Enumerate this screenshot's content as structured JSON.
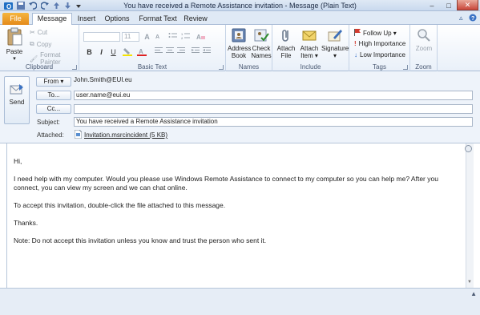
{
  "window": {
    "title": "You have received a Remote Assistance invitation  -  Message (Plain Text)",
    "minimize": "–",
    "maximize": "□",
    "close": "✕"
  },
  "tabs": {
    "file": "File",
    "items": [
      "Message",
      "Insert",
      "Options",
      "Format Text",
      "Review"
    ],
    "active": "Message"
  },
  "ribbon": {
    "clipboard": {
      "label": "Clipboard",
      "paste": "Paste",
      "cut": "Cut",
      "copy": "Copy",
      "format_painter": "Format Painter"
    },
    "basic_text": {
      "label": "Basic Text",
      "font_size": "11"
    },
    "names": {
      "label": "Names",
      "address_book": [
        "Address",
        "Book"
      ],
      "check_names": [
        "Check",
        "Names"
      ]
    },
    "include": {
      "label": "Include",
      "attach_file": [
        "Attach",
        "File"
      ],
      "attach_item": [
        "Attach",
        "Item ▾"
      ],
      "signature": [
        "Signature",
        "▾"
      ]
    },
    "tags": {
      "label": "Tags",
      "follow_up": "Follow Up ▾",
      "high_importance": "High Importance",
      "low_importance": "Low Importance"
    },
    "zoom": {
      "label": "Zoom"
    }
  },
  "header": {
    "send": "Send",
    "from_button": "From ▾",
    "from_value": "John.Smith@EUI.eu",
    "to_button": "To...",
    "to_value": "user.name@eui.eu",
    "cc_button": "Cc...",
    "cc_value": "",
    "subject_label": "Subject:",
    "subject_value": "You have received a Remote Assistance invitation",
    "attached_label": "Attached:",
    "attachment": "Invitation.msrcincident (5 KB)"
  },
  "body": {
    "paragraphs": [
      "Hi,",
      "I need help with my computer. Would you please use Windows Remote Assistance to connect to my computer so you can help me? After you connect, you can view my screen and we can chat online.",
      "To accept this invitation, double-click the file attached to this message.",
      "Thanks.",
      "Note:  Do not accept this invitation unless you know and trust the person who sent it."
    ]
  },
  "colors": {
    "file_tab": "#e48a1b",
    "ribbon_border": "#a9bcd6",
    "close_button": "#c9473a"
  }
}
